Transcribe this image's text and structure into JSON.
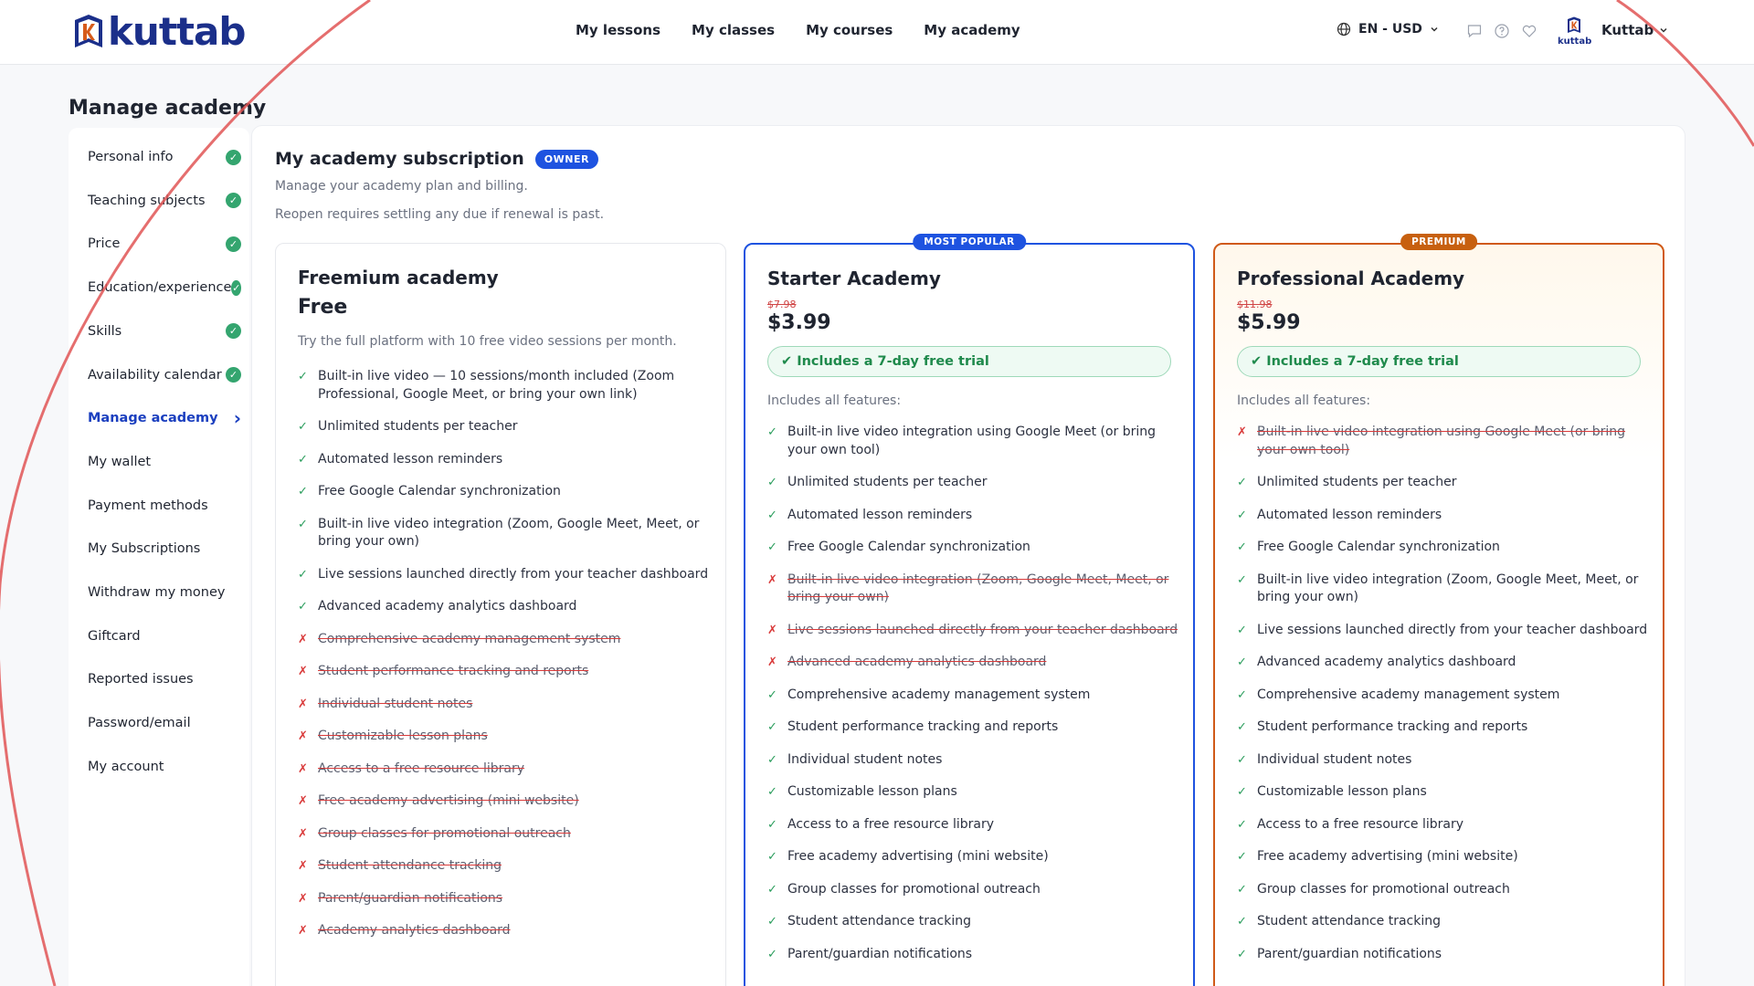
{
  "brand": {
    "name": "kuttab"
  },
  "nav": [
    {
      "label": "My lessons"
    },
    {
      "label": "My classes"
    },
    {
      "label": "My courses"
    },
    {
      "label": "My academy"
    }
  ],
  "locale": {
    "label": "EN - USD"
  },
  "header_icons": [
    "chat-icon",
    "help-icon",
    "heart-icon"
  ],
  "user": {
    "avatar_text": "kuttab",
    "name": "Kuttab"
  },
  "page": {
    "title": "Manage academy"
  },
  "sidebar": {
    "items": [
      {
        "label": "Personal info",
        "status": "complete"
      },
      {
        "label": "Teaching subjects",
        "status": "complete"
      },
      {
        "label": "Price",
        "status": "complete"
      },
      {
        "label": "Education/experience",
        "status": "complete"
      },
      {
        "label": "Skills",
        "status": "complete"
      },
      {
        "label": "Availability calendar",
        "status": "complete"
      },
      {
        "label": "Manage academy",
        "status": "active"
      },
      {
        "label": "My wallet"
      },
      {
        "label": "Payment methods"
      },
      {
        "label": "My Subscriptions"
      },
      {
        "label": "Withdraw my money"
      },
      {
        "label": "Giftcard"
      },
      {
        "label": "Reported issues"
      },
      {
        "label": "Password/email"
      },
      {
        "label": "My account"
      }
    ]
  },
  "subscription": {
    "title": "My academy subscription",
    "badge": "OWNER",
    "description": "Manage your academy plan and billing.",
    "note": "Reopen requires settling any due if renewal is past."
  },
  "plans": [
    {
      "name": "Freemium academy",
      "price": "Free",
      "tagline": "Try the full platform with 10 free video sessions per month.",
      "features": [
        {
          "text": "Built-in live video — 10 sessions/month included (Zoom Professional, Google Meet, or bring your own link)",
          "included": true
        },
        {
          "text": "Unlimited students per teacher",
          "included": true
        },
        {
          "text": "Automated lesson reminders",
          "included": true
        },
        {
          "text": "Free Google Calendar synchronization",
          "included": true
        },
        {
          "text": "Built-in live video integration (Zoom, Google Meet, Meet, or bring your own)",
          "included": true
        },
        {
          "text": "Live sessions launched directly from your teacher dashboard",
          "included": true
        },
        {
          "text": "Advanced academy analytics dashboard",
          "included": true
        },
        {
          "text": "Comprehensive academy management system",
          "included": false
        },
        {
          "text": "Student performance tracking and reports",
          "included": false
        },
        {
          "text": "Individual student notes",
          "included": false
        },
        {
          "text": "Customizable lesson plans",
          "included": false
        },
        {
          "text": "Access to a free resource library",
          "included": false
        },
        {
          "text": "Free academy advertising (mini website)",
          "included": false
        },
        {
          "text": "Group classes for promotional outreach",
          "included": false
        },
        {
          "text": "Student attendance tracking",
          "included": false
        },
        {
          "text": "Parent/guardian notifications",
          "included": false
        },
        {
          "text": "Academy analytics dashboard",
          "included": false
        }
      ]
    },
    {
      "name": "Starter Academy",
      "ribbon": "MOST POPULAR",
      "old_price": "$7.98",
      "price": "$3.99",
      "trial": "✔ Includes a 7-day free trial",
      "includes_label": "Includes all features:",
      "features": [
        {
          "text": "Built-in live video integration using Google Meet (or bring your own tool)",
          "included": true
        },
        {
          "text": "Unlimited students per teacher",
          "included": true
        },
        {
          "text": "Automated lesson reminders",
          "included": true
        },
        {
          "text": "Free Google Calendar synchronization",
          "included": true
        },
        {
          "text": "Built-in live video integration (Zoom, Google Meet, Meet, or bring your own)",
          "included": false
        },
        {
          "text": "Live sessions launched directly from your teacher dashboard",
          "included": false
        },
        {
          "text": "Advanced academy analytics dashboard",
          "included": false
        },
        {
          "text": "Comprehensive academy management system",
          "included": true
        },
        {
          "text": "Student performance tracking and reports",
          "included": true
        },
        {
          "text": "Individual student notes",
          "included": true
        },
        {
          "text": "Customizable lesson plans",
          "included": true
        },
        {
          "text": "Access to a free resource library",
          "included": true
        },
        {
          "text": "Free academy advertising (mini website)",
          "included": true
        },
        {
          "text": "Group classes for promotional outreach",
          "included": true
        },
        {
          "text": "Student attendance tracking",
          "included": true
        },
        {
          "text": "Parent/guardian notifications",
          "included": true
        }
      ]
    },
    {
      "name": "Professional Academy",
      "ribbon": "PREMIUM",
      "old_price": "$11.98",
      "price": "$5.99",
      "trial": "✔ Includes a 7-day free trial",
      "includes_label": "Includes all features:",
      "features": [
        {
          "text": "Built-in live video integration using Google Meet (or bring your own tool)",
          "included": false
        },
        {
          "text": "Unlimited students per teacher",
          "included": true
        },
        {
          "text": "Automated lesson reminders",
          "included": true
        },
        {
          "text": "Free Google Calendar synchronization",
          "included": true
        },
        {
          "text": "Built-in live video integration (Zoom, Google Meet, Meet, or bring your own)",
          "included": true
        },
        {
          "text": "Live sessions launched directly from your teacher dashboard",
          "included": true
        },
        {
          "text": "Advanced academy analytics dashboard",
          "included": true
        },
        {
          "text": "Comprehensive academy management system",
          "included": true
        },
        {
          "text": "Student performance tracking and reports",
          "included": true
        },
        {
          "text": "Individual student notes",
          "included": true
        },
        {
          "text": "Customizable lesson plans",
          "included": true
        },
        {
          "text": "Access to a free resource library",
          "included": true
        },
        {
          "text": "Free academy advertising (mini website)",
          "included": true
        },
        {
          "text": "Group classes for promotional outreach",
          "included": true
        },
        {
          "text": "Student attendance tracking",
          "included": true
        },
        {
          "text": "Parent/guardian notifications",
          "included": true
        }
      ]
    }
  ],
  "colors": {
    "brand_navy": "#1b2f8a",
    "accent_blue": "#1e53e0",
    "accent_orange": "#d05a18",
    "success_green": "#34a56f",
    "error_red": "#d93a3a"
  }
}
